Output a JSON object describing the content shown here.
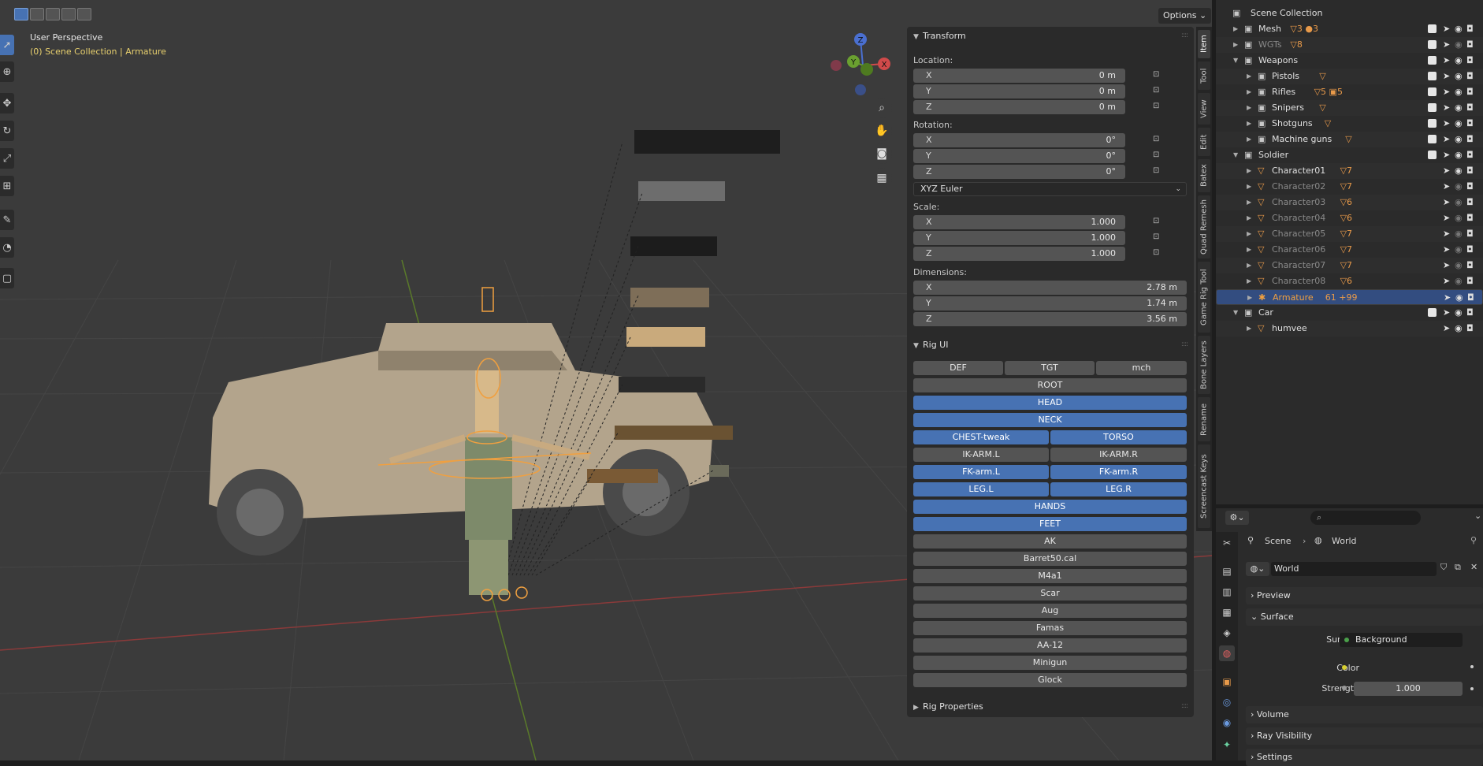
{
  "viewport": {
    "title": "User Perspective",
    "subtitle": "(0) Scene Collection | Armature",
    "options_label": "Options",
    "gizmo": {
      "z": "Z",
      "y": "Y",
      "x": "X"
    }
  },
  "transform": {
    "header": "Transform",
    "location_label": "Location:",
    "location": [
      {
        "axis": "X",
        "value": "0 m"
      },
      {
        "axis": "Y",
        "value": "0 m"
      },
      {
        "axis": "Z",
        "value": "0 m"
      }
    ],
    "rotation_label": "Rotation:",
    "rotation": [
      {
        "axis": "X",
        "value": "0°"
      },
      {
        "axis": "Y",
        "value": "0°"
      },
      {
        "axis": "Z",
        "value": "0°"
      }
    ],
    "rotation_mode": "XYZ Euler",
    "scale_label": "Scale:",
    "scale": [
      {
        "axis": "X",
        "value": "1.000"
      },
      {
        "axis": "Y",
        "value": "1.000"
      },
      {
        "axis": "Z",
        "value": "1.000"
      }
    ],
    "dimensions_label": "Dimensions:",
    "dimensions": [
      {
        "axis": "X",
        "value": "2.78 m"
      },
      {
        "axis": "Y",
        "value": "1.74 m"
      },
      {
        "axis": "Z",
        "value": "3.56 m"
      }
    ]
  },
  "rig_ui": {
    "header": "Rig UI",
    "top_row": [
      "DEF",
      "TGT",
      "mch"
    ],
    "root": "ROOT",
    "head": "HEAD",
    "neck": "NECK",
    "chest_tweak": "CHEST-tweak",
    "torso": "TORSO",
    "ik_arm_l": "IK-ARM.L",
    "ik_arm_r": "IK-ARM.R",
    "fk_arm_l": "FK-arm.L",
    "fk_arm_r": "FK-arm.R",
    "leg_l": "LEG.L",
    "leg_r": "LEG.R",
    "hands": "HANDS",
    "feet": "FEET",
    "weapons": [
      "AK",
      "Barret50.cal",
      "M4a1",
      "Scar",
      "Aug",
      "Famas",
      "AA-12",
      "Minigun",
      "Glock"
    ],
    "rig_properties": "Rig Properties"
  },
  "tabs": [
    "Item",
    "Tool",
    "View",
    "Edit",
    "Batex",
    "Quad Remesh",
    "Game Rig Tool",
    "Bone Layers",
    "Rename",
    "Screencast Keys"
  ],
  "outliner": {
    "root": "Scene Collection",
    "rows": [
      {
        "name": "Mesh",
        "data": "▽3 ●3",
        "dim": false
      },
      {
        "name": "WGTs",
        "data": "▽8",
        "dim": true
      },
      {
        "name": "Weapons",
        "data": "",
        "dim": false
      },
      {
        "name": "Pistols",
        "data": "▽",
        "dim": false
      },
      {
        "name": "Rifles",
        "data": "▽5 ▣5",
        "dim": false
      },
      {
        "name": "Snipers",
        "data": "▽",
        "dim": false
      },
      {
        "name": "Shotguns",
        "data": "▽",
        "dim": false
      },
      {
        "name": "Machine guns",
        "data": "▽",
        "dim": false
      },
      {
        "name": "Soldier",
        "data": "",
        "dim": false
      },
      {
        "name": "Character01",
        "data": "▽7",
        "dim": false
      },
      {
        "name": "Character02",
        "data": "▽7",
        "dim": true
      },
      {
        "name": "Character03",
        "data": "▽6",
        "dim": true
      },
      {
        "name": "Character04",
        "data": "▽6",
        "dim": true
      },
      {
        "name": "Character05",
        "data": "▽7",
        "dim": true
      },
      {
        "name": "Character06",
        "data": "▽7",
        "dim": true
      },
      {
        "name": "Character07",
        "data": "▽7",
        "dim": true
      },
      {
        "name": "Character08",
        "data": "▽6",
        "dim": true
      },
      {
        "name": "Armature",
        "data": "61 +99",
        "dim": false
      },
      {
        "name": "Car",
        "data": "",
        "dim": false
      },
      {
        "name": "humvee",
        "data": "",
        "dim": false
      }
    ]
  },
  "properties": {
    "breadcrumb_scene": "Scene",
    "breadcrumb_world": "World",
    "world_name": "World",
    "sections": {
      "preview": "Preview",
      "surface": "Surface",
      "volume": "Volume",
      "ray_visibility": "Ray Visibility",
      "settings": "Settings"
    },
    "surface_label": "Surface",
    "surface_value": "Background",
    "color_label": "Color",
    "strength_label": "Strength",
    "strength_value": "1.000"
  },
  "colors": {
    "accent": "#4772b3",
    "armature": "#f0a040",
    "selected_row": "#334d80"
  }
}
